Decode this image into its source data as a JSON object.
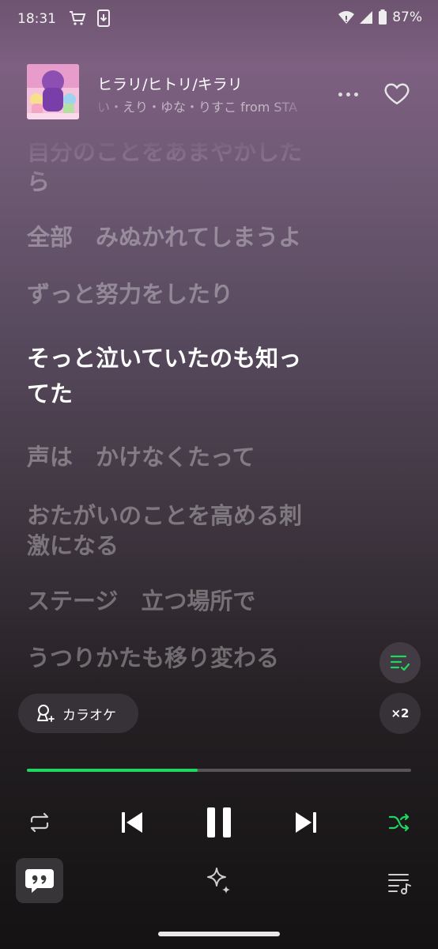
{
  "status_bar": {
    "time": "18:31",
    "battery": "87%"
  },
  "now_playing": {
    "title": "ヒラリ/ヒトリ/キラリ",
    "artist": "い・えり・ゆな・りすこ from STA",
    "liked": false
  },
  "lyrics": [
    "自分のことをあまやかした",
    "ら",
    "全部　みぬかれてしまうよ",
    "ずっと努力をしたり",
    "そっと泣いていたのも知っ",
    "てた",
    "声は　かけなくたって",
    "おたがいのことを高める刺",
    "激になる",
    "ステージ　立つ場所で",
    "うつりかたも移り変わる"
  ],
  "controls": {
    "karaoke_label": "カラオケ",
    "speed_label": "×2",
    "progress_fraction": 0.445
  },
  "colors": {
    "accent": "#1ed760"
  }
}
